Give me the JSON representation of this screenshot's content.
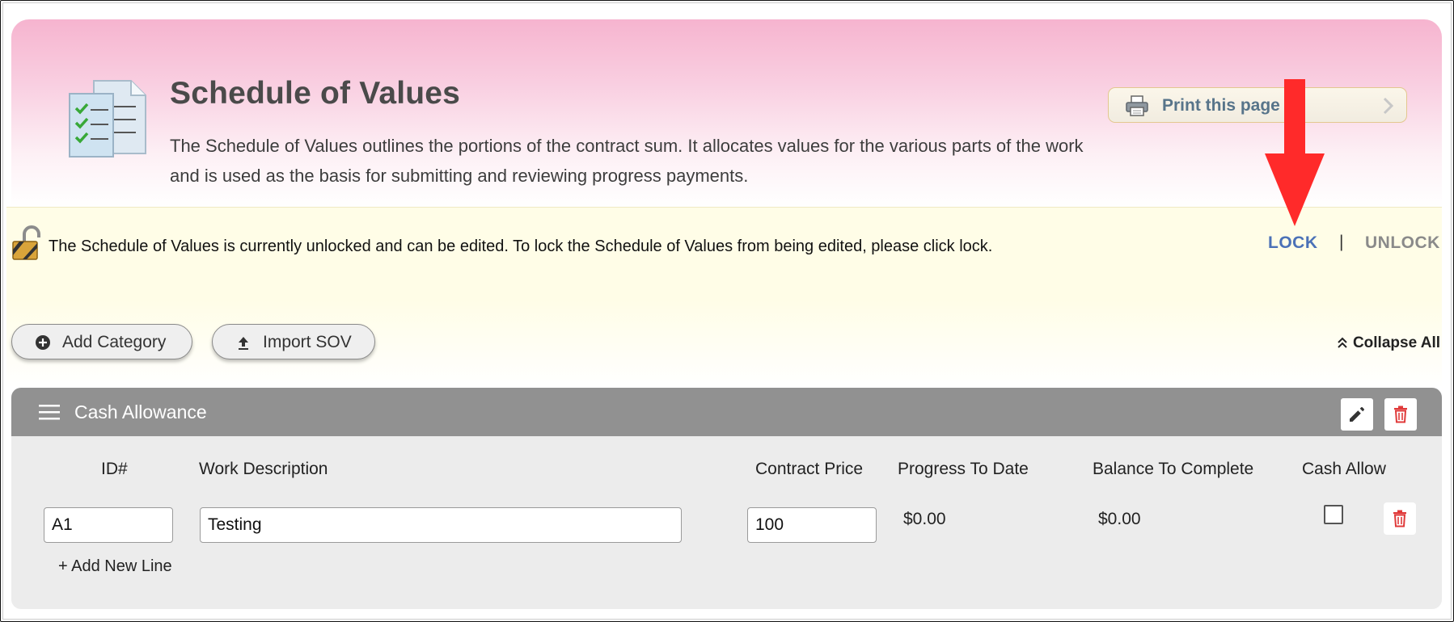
{
  "header": {
    "title": "Schedule of Values",
    "description": "The Schedule of Values outlines the portions of the contract sum. It allocates values for the various parts of the work and is used as the basis for submitting and reviewing progress payments.",
    "print_label": "Print this page",
    "icons": {
      "document": "checklist-document-icon",
      "print": "printer-icon",
      "chevron": "chevron-right-icon"
    }
  },
  "lock_bar": {
    "message": "The Schedule of Values is currently unlocked and can be edited. To lock the Schedule of Values from being edited, please click lock.",
    "lock_label": "LOCK",
    "separator": "|",
    "unlock_label": "UNLOCK",
    "icon": "open-padlock-icon"
  },
  "toolbar": {
    "add_category_label": "Add Category",
    "import_sov_label": "Import SOV",
    "collapse_all_label": "Collapse All"
  },
  "category": {
    "title": "Cash Allowance",
    "columns": [
      "ID#",
      "Work Description",
      "Contract Price",
      "Progress To Date",
      "Balance To Complete",
      "Cash Allow"
    ],
    "rows": [
      {
        "id": "A1",
        "description": "Testing",
        "contract_price": "100",
        "progress_to_date": "$0.00",
        "balance_to_complete": "$0.00",
        "cash_allow": false
      }
    ],
    "add_line_label": "+ Add New Line"
  },
  "colors": {
    "header_pink": "#f6b4cf",
    "lock_bar_bg": "#fffde7",
    "lock_link": "#4b71b7",
    "unlock_link": "#8a8a8a",
    "category_header": "#919191",
    "delete_red": "#e03a3a",
    "annotation_arrow": "#ff2a2a"
  }
}
